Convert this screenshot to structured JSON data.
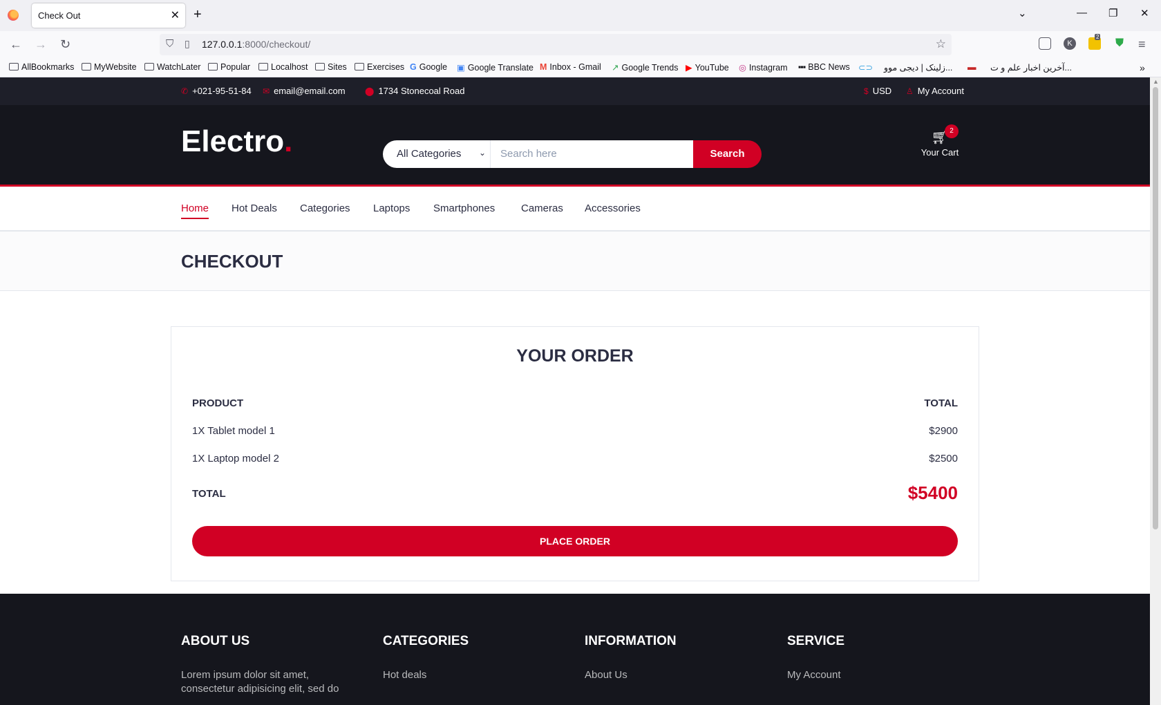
{
  "browser": {
    "tab_title": "Check Out",
    "url_host": "127.0.0.1",
    "url_rest": ":8000/checkout/",
    "bookmarks": [
      "AllBookmarks",
      "MyWebsite",
      "WatchLater",
      "Popular",
      "Localhost",
      "Sites",
      "Exercises",
      "Google",
      "Google Translate",
      "Inbox - Gmail",
      "Google Trends",
      "YouTube",
      "Instagram",
      "BBC News",
      "زلینک | دیجی موو...",
      "آخرین اخبار علم و ت..."
    ],
    "ext_badge": "2"
  },
  "top_header": {
    "phone": "+021-95-51-84",
    "email": "email@email.com",
    "address": "1734 Stonecoal Road",
    "currency": "USD",
    "account": "My Account"
  },
  "header": {
    "logo": "Electro",
    "logo_dot": ".",
    "category_select": "All Categories",
    "search_placeholder": "Search here",
    "search_button": "Search",
    "cart_label": "Your Cart",
    "cart_count": "2"
  },
  "nav": {
    "links": [
      "Home",
      "Hot Deals",
      "Categories",
      "Laptops",
      "Smartphones",
      "Cameras",
      "Accessories"
    ]
  },
  "breadcrumb": {
    "title": "CHECKOUT"
  },
  "order": {
    "title": "YOUR ORDER",
    "col_product": "PRODUCT",
    "col_total": "TOTAL",
    "items": [
      {
        "name": "1X Tablet model 1",
        "price": "$2900"
      },
      {
        "name": "1X Laptop model 2",
        "price": "$2500"
      }
    ],
    "total_label": "TOTAL",
    "total_value": "$5400",
    "place_order": "PLACE ORDER"
  },
  "footer": {
    "about_title": "ABOUT US",
    "about_text": "Lorem ipsum dolor sit amet, consectetur adipisicing elit, sed do",
    "categories_title": "CATEGORIES",
    "categories_first": "Hot deals",
    "information_title": "INFORMATION",
    "information_first": "About Us",
    "service_title": "SERVICE",
    "service_first": "My Account"
  },
  "colors": {
    "accent": "#d10024",
    "dark": "#15161d",
    "topbar": "#1e1f29"
  }
}
